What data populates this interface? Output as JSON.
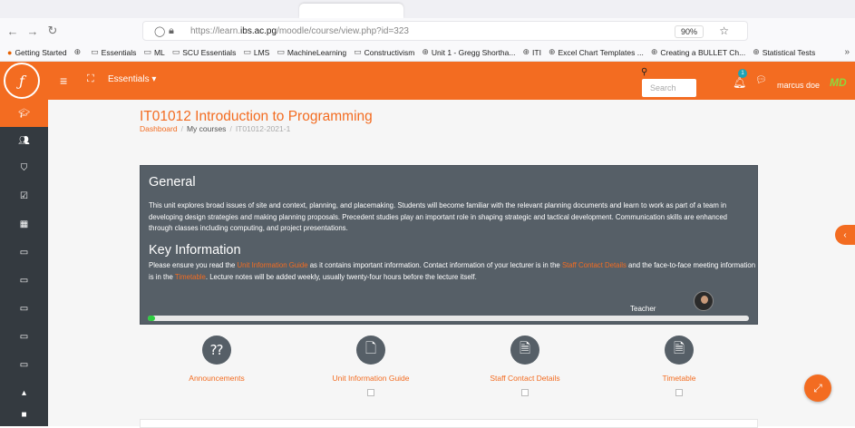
{
  "browser": {
    "url_prefix": "https://learn.",
    "url_domain": "ibs.ac.pg",
    "url_path": "/moodle/course/view.php?id=323",
    "zoom": "90%",
    "bookmarks": [
      {
        "label": "Getting Started",
        "icon": "firefox-icon"
      },
      {
        "label": "",
        "icon": "globe-icon"
      },
      {
        "label": "Essentials",
        "icon": "folder-icon"
      },
      {
        "label": "ML",
        "icon": "folder-icon"
      },
      {
        "label": "SCU Essentials",
        "icon": "folder-icon"
      },
      {
        "label": "LMS",
        "icon": "folder-icon"
      },
      {
        "label": "MachineLearning",
        "icon": "folder-icon"
      },
      {
        "label": "Constructivism",
        "icon": "folder-icon"
      },
      {
        "label": "Unit 1 - Gregg Shortha...",
        "icon": "globe-icon"
      },
      {
        "label": "ITI",
        "icon": "globe-icon"
      },
      {
        "label": "Excel Chart Templates ...",
        "icon": "globe-icon"
      },
      {
        "label": "Creating a BULLET Ch...",
        "icon": "globe-icon"
      },
      {
        "label": "Statistical Tests",
        "icon": "globe-icon"
      }
    ]
  },
  "header": {
    "menu_label": "Essentials ▾",
    "search_placeholder": "Search",
    "notification_count": "1",
    "user_name": "marcus doe",
    "avatar_initials": "MD"
  },
  "course": {
    "title": "IT01012 Introduction to Programming",
    "breadcrumb": [
      "Dashboard",
      "My courses",
      "IT01012-2021-1"
    ]
  },
  "general": {
    "heading": "General",
    "description": "This unit explores broad issues of site and context, planning, and placemaking. Students will become familiar with the relevant planning documents and learn to work as part of a team in developing design strategies and making planning proposals. Precedent studies play an important role in shaping strategic and tactical development. Communication skills are enhanced through classes including computing, and project presentations.",
    "key_heading": "Key Information",
    "key_1": "Please ensure you read the ",
    "key_link_1": "Unit Information Guide",
    "key_2": " as it contains important information. Contact information of your lecturer is in the ",
    "key_link_2": "Staff Contact Details",
    "key_3": " and the face-to-face meeting information is in the ",
    "key_link_3": "Timetable",
    "key_4": ".  Lecture notes will be added weekly, usually twenty-four hours before the lecture itself.",
    "teacher_label": "Teacher",
    "progress_percent": 1
  },
  "tiles": [
    {
      "label": "Announcements",
      "icon": "announcements-icon"
    },
    {
      "label": "Unit Information Guide",
      "icon": "document-icon"
    },
    {
      "label": "Staff Contact Details",
      "icon": "document-lines-icon"
    },
    {
      "label": "Timetable",
      "icon": "document-lines-icon"
    }
  ],
  "colors": {
    "brand": "#f36c21",
    "sidebar": "#343a40",
    "panel": "#565f67"
  }
}
